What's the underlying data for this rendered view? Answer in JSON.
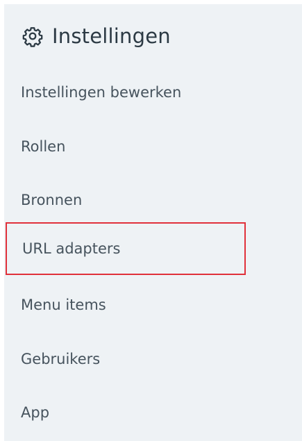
{
  "panel": {
    "icon": "gear-icon",
    "title": "Instellingen"
  },
  "menu": {
    "selected_index": 3,
    "selection_color": "#e0303a",
    "items": [
      {
        "label": "Instellingen bewerken"
      },
      {
        "label": "Rollen"
      },
      {
        "label": "Bronnen"
      },
      {
        "label": "URL adapters"
      },
      {
        "label": "Menu items"
      },
      {
        "label": "Gebruikers"
      },
      {
        "label": "App"
      }
    ]
  }
}
